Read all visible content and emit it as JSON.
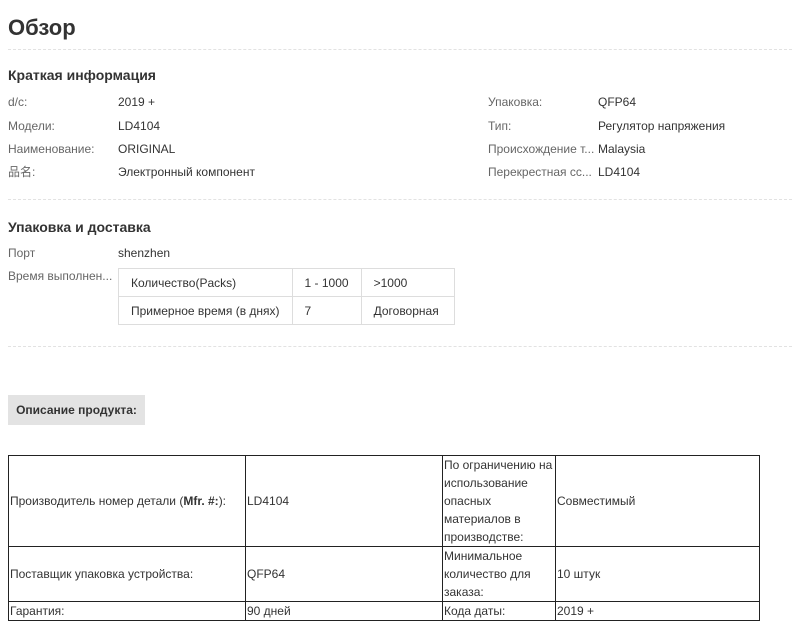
{
  "overview": {
    "title": "Обзор"
  },
  "brief": {
    "heading": "Краткая информация",
    "left": [
      {
        "label": "d/c:",
        "value": "2019 +"
      },
      {
        "label": "Модели:",
        "value": "LD4104"
      },
      {
        "label": "Наименование:",
        "value": "ORIGINAL"
      },
      {
        "label": "品名:",
        "value": "Электронный компонент"
      }
    ],
    "right": [
      {
        "label": "Упаковка:",
        "value": "QFP64"
      },
      {
        "label": "Тип:",
        "value": "Регулятор напряжения"
      },
      {
        "label": "Происхождение т...",
        "value": "Malaysia"
      },
      {
        "label": "Перекрестная сс...",
        "value": "LD4104"
      }
    ]
  },
  "shipping": {
    "heading": "Упаковка и доставка",
    "port_label": "Порт",
    "port_value": "shenzhen",
    "lead_label": "Время выполнен...",
    "lead_table": [
      [
        "Количество(Packs)",
        "1 - 1000",
        ">1000"
      ],
      [
        "Примерное время (в днях)",
        "7",
        "Договорная"
      ]
    ]
  },
  "description": {
    "button_label": "Описание продукта:",
    "rows": [
      {
        "c1_pre": "Производитель номер детали (",
        "c1_bold": "Mfr. #:",
        "c1_post": "):",
        "c2": "LD4104",
        "c3": "По ограничению на использование опасных материалов в производстве:",
        "c4": "Совместимый"
      },
      {
        "c1": "Поставщик упаковка устройства:",
        "c2": "QFP64",
        "c3": "Минимальное количество для заказа:",
        "c4": "10 штук"
      },
      {
        "c1": "Гарантия:",
        "c2": "90 дней",
        "c3": "Кода даты:",
        "c4": "2019 +"
      }
    ]
  }
}
